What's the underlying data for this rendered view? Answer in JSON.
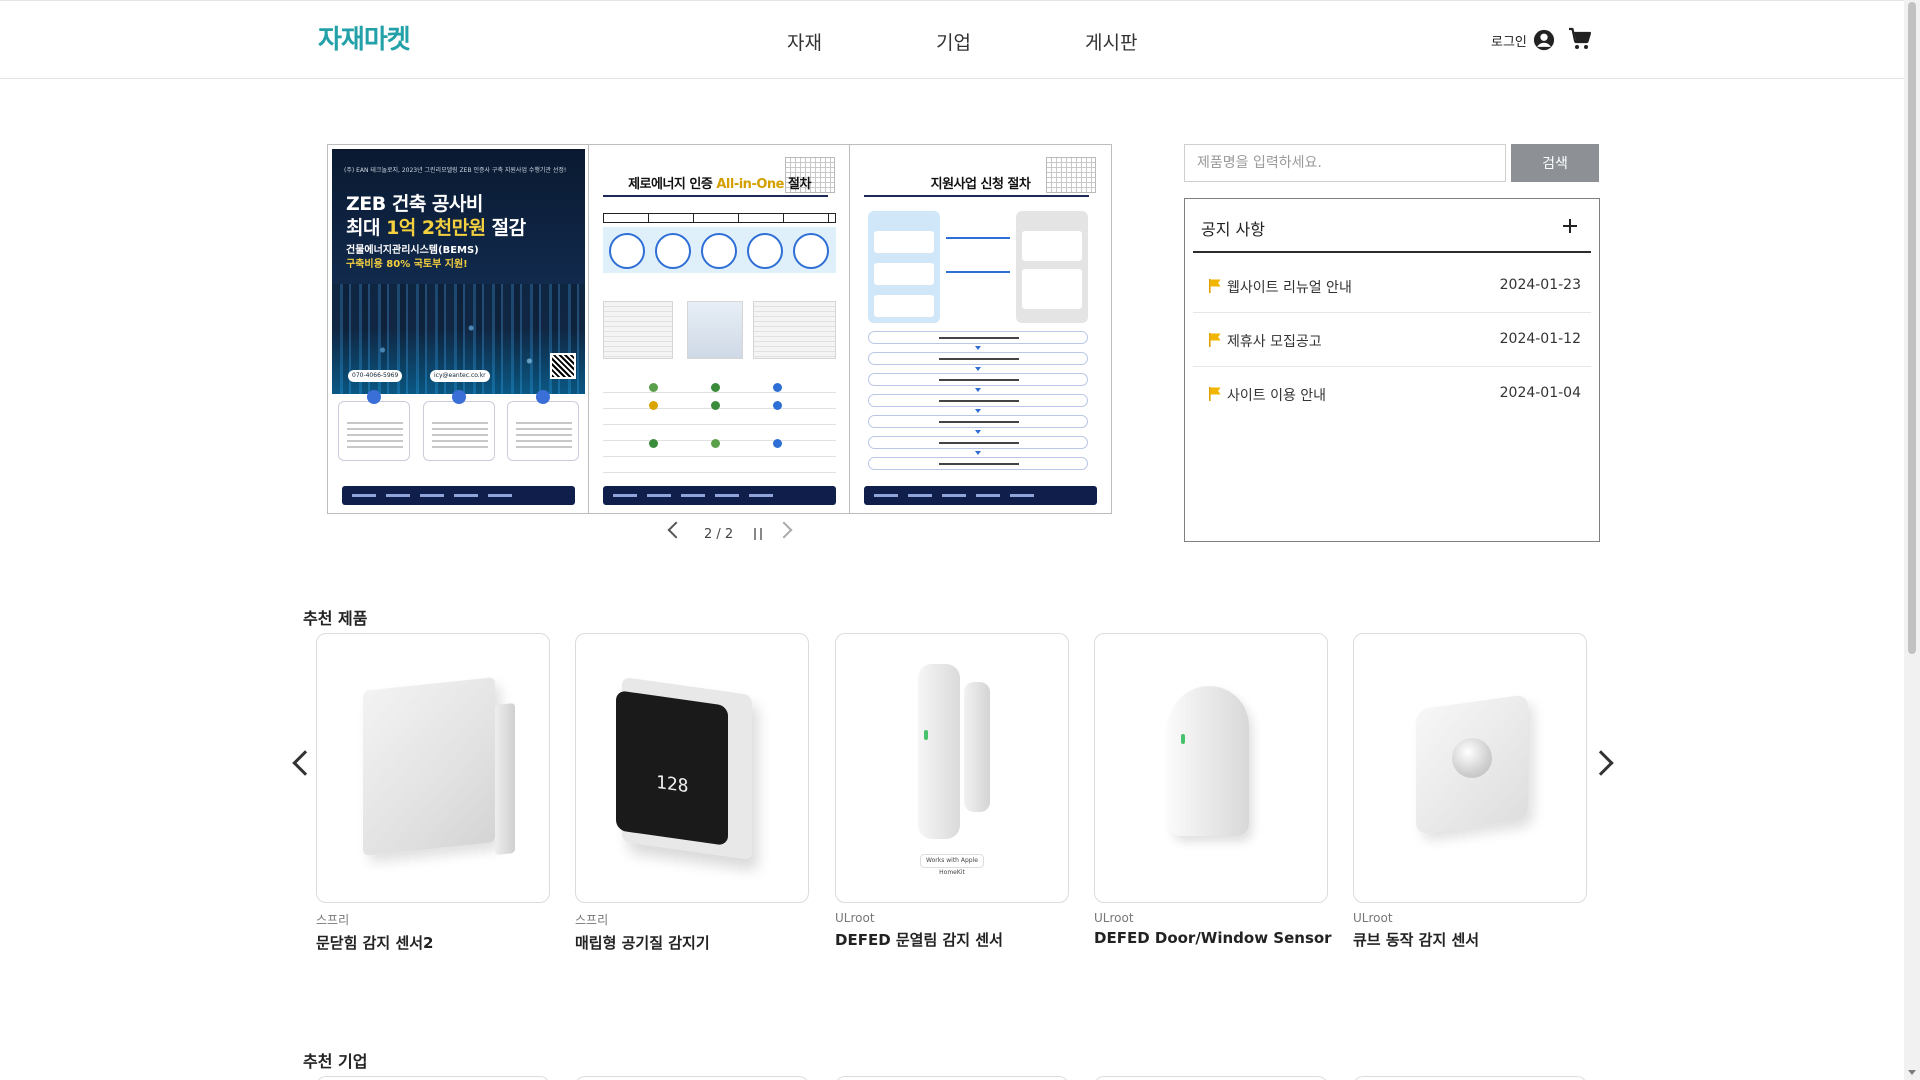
{
  "header": {
    "logo": "자재마켓",
    "nav": [
      "자재",
      "기업",
      "게시판"
    ],
    "login": "로그인",
    "icons": {
      "user": "user-circle-icon",
      "cart": "cart-icon"
    }
  },
  "banner": {
    "poster1": {
      "small": "(주) EAN 테크놀로지, 2023년 그린리모델링 ZEB 인증사 구축 지원사업 수행기관 선정!",
      "headline1": "ZEB 건축 공사비",
      "headline2_pre": "최대 ",
      "headline2_hl": "1억 2천만원",
      "headline2_post": " 절감",
      "sub1": "건물에너지관리시스템(BEMS)",
      "sub2": "구축비용 80% 국토부 지원!",
      "phone": "070-4066-5969",
      "email": "icy@eantec.co.kr"
    },
    "poster2": {
      "title_pre": "제로에너지 인증 ",
      "title_hl": "All-in-One",
      "title_post": " 절차"
    },
    "poster3": {
      "title": "지원사업 신청 절차"
    },
    "counter": "2 / 2"
  },
  "search": {
    "placeholder": "제품명을 입력하세요.",
    "button": "검색"
  },
  "notice": {
    "title": "공지 사항",
    "items": [
      {
        "text": "웹사이트 리뉴얼 안내",
        "date": "2024-01-23"
      },
      {
        "text": "제휴사 모집공고",
        "date": "2024-01-12"
      },
      {
        "text": "사이트 이용 안내",
        "date": "2024-01-04"
      }
    ]
  },
  "recommended_products": {
    "title": "추천 제품",
    "items": [
      {
        "brand": "스프리",
        "name": "문닫힘 감지 센서2"
      },
      {
        "brand": "스프리",
        "name": "매립형 공기질 감지기"
      },
      {
        "brand": "ULroot",
        "name": "DEFED 문열림 감지 센서"
      },
      {
        "brand": "ULroot",
        "name": "DEFED Door/Window Sensor"
      },
      {
        "brand": "ULroot",
        "name": "큐브 동작 감지 센서"
      }
    ],
    "aq_display": "128",
    "homekit_badge": "Works with Apple HomeKit"
  },
  "recommended_companies": {
    "title": "추천 기업"
  },
  "colors": {
    "brand": "#22a1a8",
    "search_button": "#8d9196",
    "notice_flag": "#f2b600"
  }
}
